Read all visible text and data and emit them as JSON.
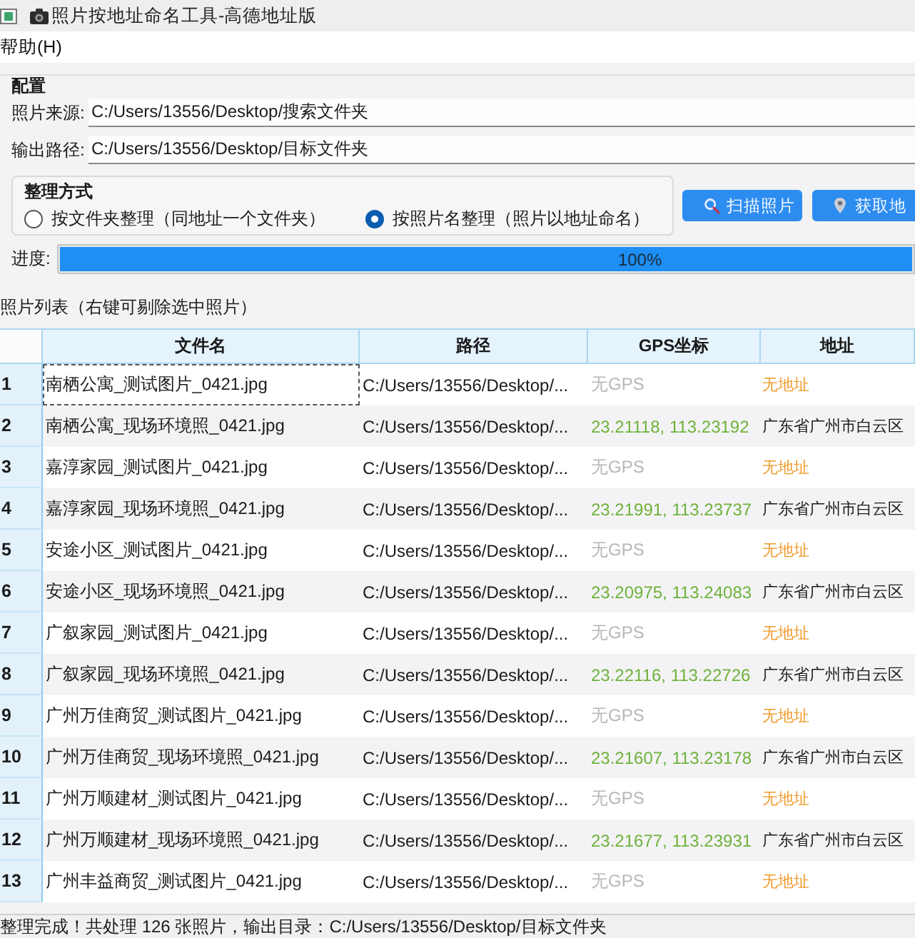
{
  "window": {
    "title": "照片按地址命名工具-高德地址版"
  },
  "menu": [
    {
      "label": "帮助(H)"
    }
  ],
  "config": {
    "title": "配置",
    "fields": [
      {
        "label": "照片来源:",
        "value": "C:/Users/13556/Desktop/搜索文件夹"
      },
      {
        "label": "输出路径:",
        "value": "C:/Users/13556/Desktop/目标文件夹"
      }
    ],
    "mode": {
      "title": "整理方式",
      "options": [
        {
          "label": "按文件夹整理（同地址一个文件夹）",
          "selected": false
        },
        {
          "label": "按照片名整理（照片以地址命名）",
          "selected": true
        }
      ]
    },
    "buttons": [
      {
        "label": "扫描照片",
        "kind": "scan"
      },
      {
        "label": "获取地",
        "kind": "locate"
      }
    ],
    "progress": {
      "label": "进度:",
      "level": 1,
      "reading": "100%"
    }
  },
  "photo_list": {
    "title": "照片列表（右键可剔除选中照片）",
    "columns": [
      "文件名",
      "路径",
      "GPS坐标",
      "地址"
    ],
    "rows": [
      {
        "number": "1",
        "file": "南栖公寓_测试图片_0421.jpg",
        "path": "C:/Users/13556/Desktop/...",
        "gps": "无GPS",
        "address": "无地址",
        "kind": "missing",
        "focused": true
      },
      {
        "number": "2",
        "file": "南栖公寓_现场环境照_0421.jpg",
        "path": "C:/Users/13556/Desktop/...",
        "gps": "23.21118, 113.23192",
        "address": "广东省广州市白云区",
        "kind": "located",
        "focused": false
      },
      {
        "number": "3",
        "file": "嘉淳家园_测试图片_0421.jpg",
        "path": "C:/Users/13556/Desktop/...",
        "gps": "无GPS",
        "address": "无地址",
        "kind": "missing",
        "focused": false
      },
      {
        "number": "4",
        "file": "嘉淳家园_现场环境照_0421.jpg",
        "path": "C:/Users/13556/Desktop/...",
        "gps": "23.21991, 113.23737",
        "address": "广东省广州市白云区",
        "kind": "located",
        "focused": false
      },
      {
        "number": "5",
        "file": "安途小区_测试图片_0421.jpg",
        "path": "C:/Users/13556/Desktop/...",
        "gps": "无GPS",
        "address": "无地址",
        "kind": "missing",
        "focused": false
      },
      {
        "number": "6",
        "file": "安途小区_现场环境照_0421.jpg",
        "path": "C:/Users/13556/Desktop/...",
        "gps": "23.20975, 113.24083",
        "address": "广东省广州市白云区",
        "kind": "located",
        "focused": false
      },
      {
        "number": "7",
        "file": "广叙家园_测试图片_0421.jpg",
        "path": "C:/Users/13556/Desktop/...",
        "gps": "无GPS",
        "address": "无地址",
        "kind": "missing",
        "focused": false
      },
      {
        "number": "8",
        "file": "广叙家园_现场环境照_0421.jpg",
        "path": "C:/Users/13556/Desktop/...",
        "gps": "23.22116, 113.22726",
        "address": "广东省广州市白云区",
        "kind": "located",
        "focused": false
      },
      {
        "number": "9",
        "file": "广州万佳商贸_测试图片_0421.jpg",
        "path": "C:/Users/13556/Desktop/...",
        "gps": "无GPS",
        "address": "无地址",
        "kind": "missing",
        "focused": false
      },
      {
        "number": "10",
        "file": "广州万佳商贸_现场环境照_0421.jpg",
        "path": "C:/Users/13556/Desktop/...",
        "gps": "23.21607, 113.23178",
        "address": "广东省广州市白云区",
        "kind": "located",
        "focused": false
      },
      {
        "number": "11",
        "file": "广州万顺建材_测试图片_0421.jpg",
        "path": "C:/Users/13556/Desktop/...",
        "gps": "无GPS",
        "address": "无地址",
        "kind": "missing",
        "focused": false
      },
      {
        "number": "12",
        "file": "广州万顺建材_现场环境照_0421.jpg",
        "path": "C:/Users/13556/Desktop/...",
        "gps": "23.21677, 113.23931",
        "address": "广东省广州市白云区",
        "kind": "located",
        "focused": false
      },
      {
        "number": "13",
        "file": "广州丰益商贸_测试图片_0421.jpg",
        "path": "C:/Users/13556/Desktop/...",
        "gps": "无GPS",
        "address": "无地址",
        "kind": "missing",
        "focused": false
      }
    ]
  },
  "status_bar": {
    "text": "整理完成！共处理 126 张照片，输出目录：C:/Users/13556/Desktop/目标文件夹"
  }
}
